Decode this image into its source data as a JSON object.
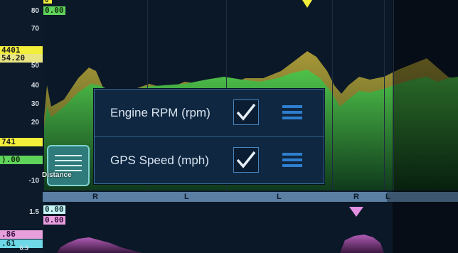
{
  "upper_axis": {
    "ticks": [
      "80",
      "70",
      "50",
      "40",
      "30",
      "20",
      "-10"
    ]
  },
  "value_badges": {
    "top_marker": "0",
    "top_value": "0.00",
    "rpm_cursor": "4401",
    "speed_cursor": "54.20",
    "mid_value": "741",
    "mid_zero": ").00"
  },
  "lower_axis": {
    "tick": "1.5",
    "badge_a": "0.00",
    "badge_b": "0.00",
    "badge_c": ".86",
    "badge_d": ".61",
    "bottom_tick": "0.3"
  },
  "track_segments": [
    "R",
    "L",
    "L",
    "R",
    "L"
  ],
  "popup": {
    "rows": [
      {
        "label": "Engine RPM (rpm)",
        "checked": true,
        "icon": "menu-icon"
      },
      {
        "label": "GPS Speed (mph)",
        "checked": true,
        "icon": "menu-icon"
      }
    ]
  },
  "chart_menu_button": {
    "label": "Distance",
    "icon": "list-icon"
  },
  "colors": {
    "rpm_series": "#b7a93a",
    "speed_series": "#49b23f",
    "lower_series": "#a04ca0",
    "accent_blue": "#2e7fd0",
    "marker_yellow": "#f3ee3a",
    "marker_pink": "#e290e4"
  }
}
